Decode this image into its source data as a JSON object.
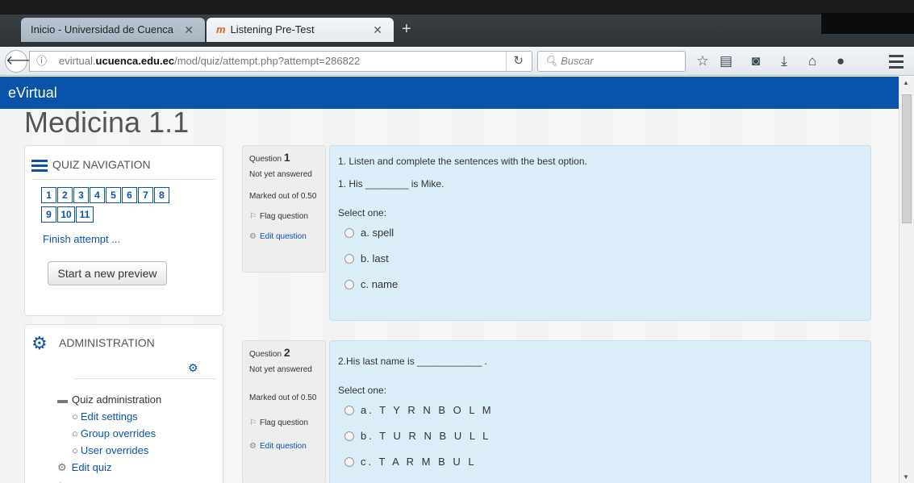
{
  "browser": {
    "tabs": [
      {
        "label": "Inicio - Universidad de Cuenca",
        "active": false
      },
      {
        "label": "Listening Pre-Test",
        "active": true,
        "favicon": "moodle-icon"
      }
    ],
    "url_prefix": "evirtual.",
    "url_domain": "ucuenca.edu.ec",
    "url_path": "/mod/quiz/attempt.php?attempt=286822",
    "search_placeholder": "Buscar"
  },
  "site": {
    "name": "eVirtual",
    "course_title": "Medicina 1.1"
  },
  "quiz_nav": {
    "title": "QUIZ NAVIGATION",
    "questions": [
      "1",
      "2",
      "3",
      "4",
      "5",
      "6",
      "7",
      "8",
      "9",
      "10",
      "11"
    ],
    "finish_label": "Finish attempt ...",
    "preview_label": "Start a new preview"
  },
  "admin": {
    "title": "ADMINISTRATION",
    "items": [
      {
        "label": "Quiz administration",
        "level": 1
      },
      {
        "label": "Edit settings",
        "level": 2
      },
      {
        "label": "Group overrides",
        "level": 2
      },
      {
        "label": "User overrides",
        "level": 2
      },
      {
        "label": "Edit quiz",
        "level": 0
      }
    ]
  },
  "questions": [
    {
      "label": "Question",
      "number": "1",
      "status": "Not yet answered",
      "marks": "Marked out of 0.50",
      "flag": "Flag question",
      "edit": "Edit question",
      "instruction": "1. Listen and complete the sentences with the best option.",
      "prompt": "1. His ________ is Mike.",
      "select_one": "Select one:",
      "options": [
        "a. spell",
        "b. last",
        "c. name"
      ]
    },
    {
      "label": "Question",
      "number": "2",
      "status": "Not yet answered",
      "marks": "Marked out of 0.50",
      "flag": "Flag question",
      "edit": "Edit question",
      "prompt": "2.His last name is ____________ .",
      "select_one": "Select one:",
      "options": [
        "a. T Y R N B O L M",
        "b. T U R N B U L L",
        "c. T A R M B U L"
      ]
    }
  ],
  "colors": {
    "brand": "#0954aa",
    "question_bg": "#dceef7",
    "info_bg": "#eeeeee"
  }
}
